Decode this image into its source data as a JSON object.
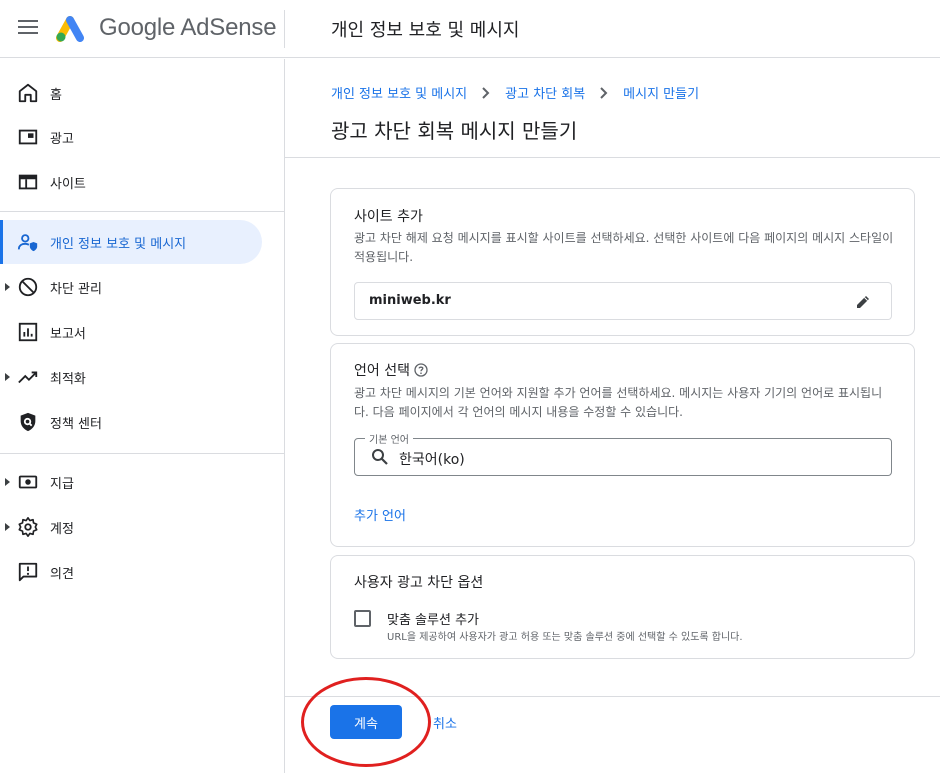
{
  "app": {
    "name": "Google AdSense",
    "header_title": "개인 정보 보호 및 메시지"
  },
  "sidebar": {
    "items": [
      {
        "label": "홈",
        "icon": "home-icon"
      },
      {
        "label": "광고",
        "icon": "ads-icon"
      },
      {
        "label": "사이트",
        "icon": "sites-icon"
      },
      {
        "label": "개인 정보 보호 및 메시지",
        "icon": "privacy-messaging-icon",
        "active": true
      },
      {
        "label": "차단 관리",
        "icon": "block-icon",
        "expandable": true
      },
      {
        "label": "보고서",
        "icon": "reports-icon"
      },
      {
        "label": "최적화",
        "icon": "optimization-icon",
        "expandable": true
      },
      {
        "label": "정책 센터",
        "icon": "policy-center-icon"
      },
      {
        "label": "지급",
        "icon": "payments-icon",
        "expandable": true
      },
      {
        "label": "계정",
        "icon": "account-gear-icon",
        "expandable": true
      },
      {
        "label": "의견",
        "icon": "feedback-icon"
      }
    ]
  },
  "breadcrumb": [
    "개인 정보 보호 및 메시지",
    "광고 차단 회복",
    "메시지 만들기"
  ],
  "main": {
    "title": "광고 차단 회복 메시지 만들기"
  },
  "sites_card": {
    "title": "사이트 추가",
    "description": "광고 차단 해제 요청 메시지를 표시할 사이트를 선택하세요. 선택한 사이트에 다음 페이지의 메시지 스타일이 적용됩니다.",
    "site_value": "miniweb.kr"
  },
  "language_card": {
    "title": "언어 선택",
    "description": "광고 차단 메시지의 기본 언어와 지원할 추가 언어를 선택하세요. 메시지는 사용자 기기의 언어로 표시됩니다. 다음 페이지에서 각 언어의 메시지 내용을 수정할 수 있습니다.",
    "default_language_label": "기본 언어",
    "default_language_value": "한국어(ko)",
    "add_language_link": "추가 언어"
  },
  "options_card": {
    "title": "사용자 광고 차단 옵션",
    "checkbox_label": "맞춤 솔루션 추가",
    "checkbox_sub": "URL을 제공하여 사용자가 광고 허용 또는 맞춤 솔루션 중에 선택할 수 있도록 합니다.",
    "checked": false
  },
  "footer": {
    "continue_label": "계속",
    "cancel_label": "취소"
  },
  "colors": {
    "accent": "#1a73e8",
    "active_bg": "#e8f0fe",
    "annotation_red": "#e0201f"
  }
}
